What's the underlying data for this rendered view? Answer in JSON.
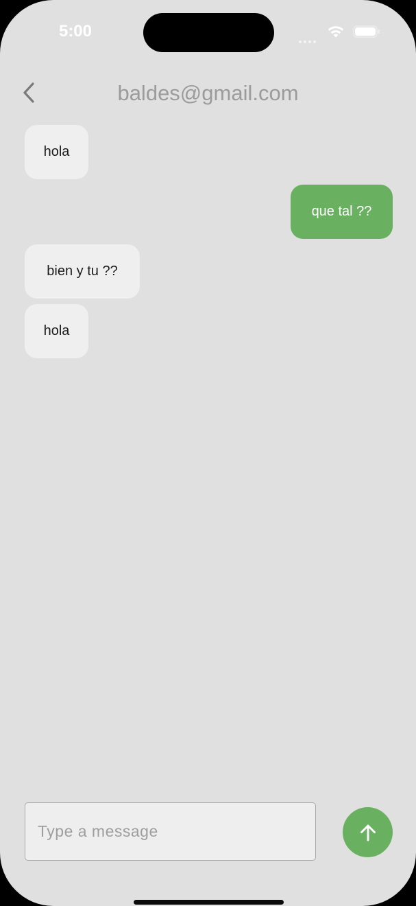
{
  "status_bar": {
    "time": "5:00",
    "icons": [
      "signal-icon",
      "wifi-icon",
      "battery-icon"
    ]
  },
  "header": {
    "back_icon": "chevron-left-icon",
    "title": "baldes@gmail.com"
  },
  "messages": [
    {
      "text": "hola",
      "direction": "received"
    },
    {
      "text": "que tal ??",
      "direction": "sent"
    },
    {
      "text": "bien y tu ??",
      "direction": "received"
    },
    {
      "text": "hola",
      "direction": "received"
    }
  ],
  "composer": {
    "value": "",
    "placeholder": "Type a message",
    "send_icon": "arrow-up-icon"
  },
  "colors": {
    "background": "#e0e0e0",
    "sent_bubble": "#6ab061",
    "received_bubble": "#efefef",
    "title": "#9b9b9b"
  }
}
